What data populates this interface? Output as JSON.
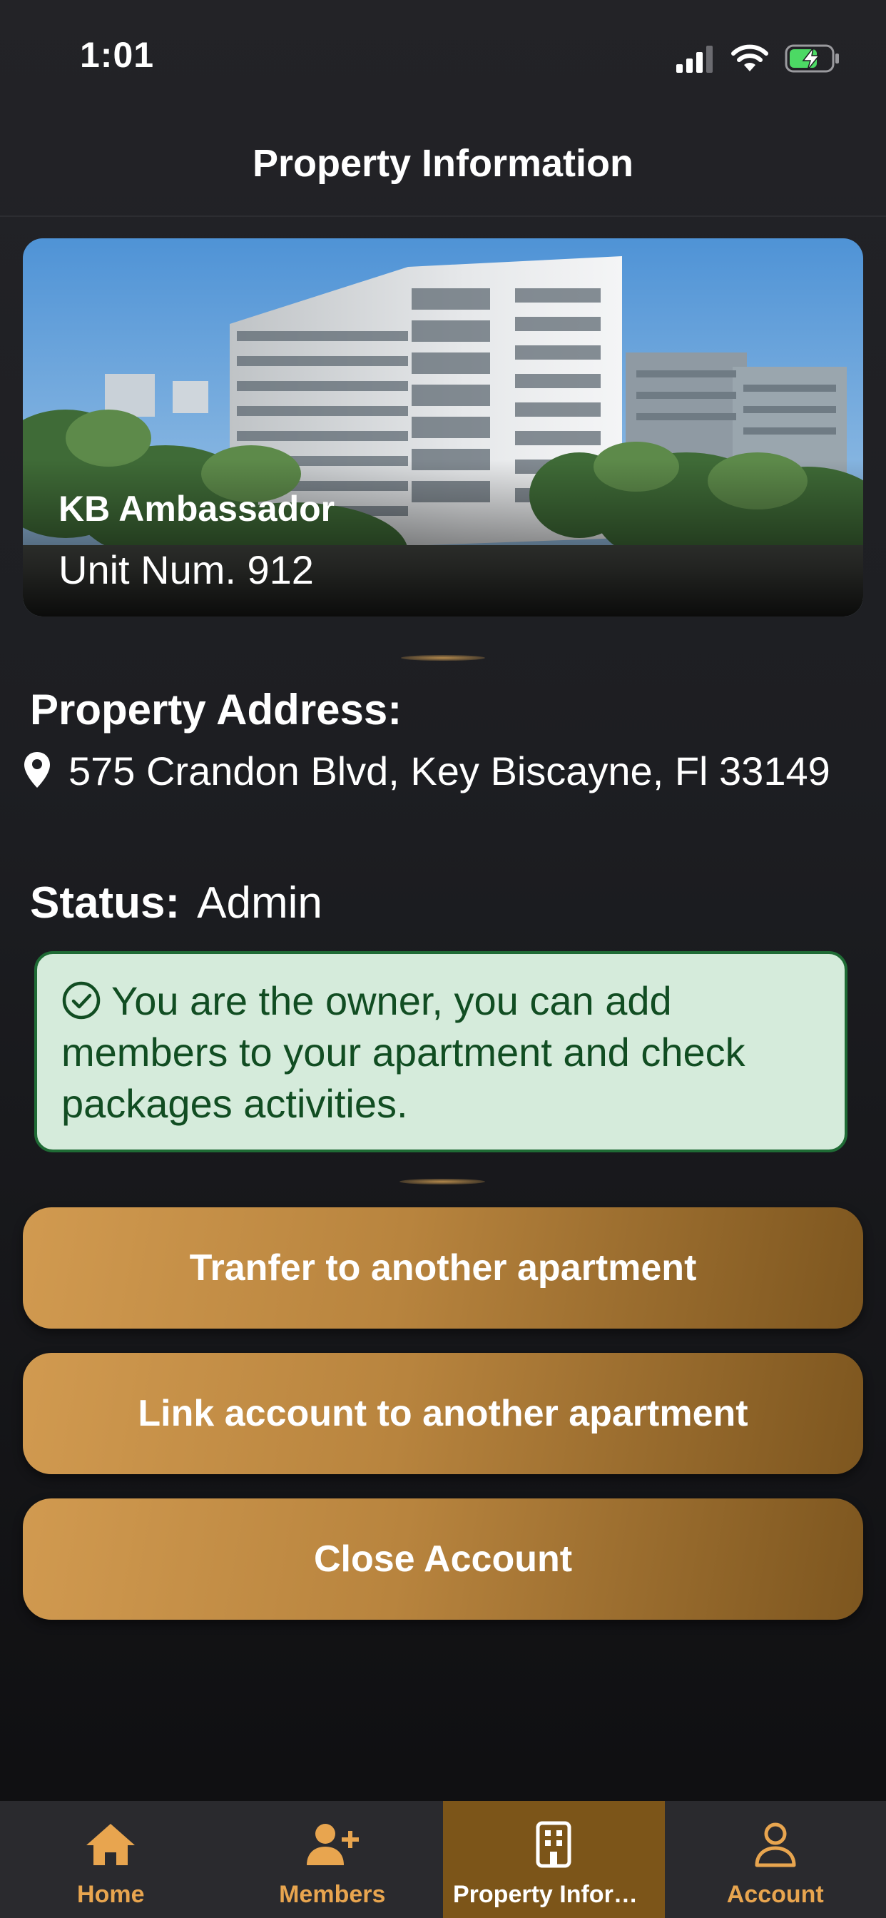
{
  "status_bar": {
    "time": "1:01"
  },
  "header": {
    "title": "Property Information"
  },
  "property": {
    "name": "KB Ambassador",
    "unit": "Unit Num. 912"
  },
  "address": {
    "heading": "Property Address:",
    "text": "575 Crandon Blvd, Key Biscayne, Fl 33149"
  },
  "status": {
    "label": "Status:",
    "value": "Admin"
  },
  "notice": {
    "text": "You are the owner, you can add members to your apartment and check packages activities."
  },
  "actions": {
    "transfer": "Tranfer to another apartment",
    "link": "Link account to another apartment",
    "close": "Close Account"
  },
  "tabs": [
    {
      "label": "Home",
      "icon": "home-icon",
      "active": false
    },
    {
      "label": "Members",
      "icon": "add-member-icon",
      "active": false
    },
    {
      "label": "Property Information",
      "icon": "building-icon",
      "active": true
    },
    {
      "label": "Account",
      "icon": "user-icon",
      "active": false
    }
  ],
  "colors": {
    "accent_gold": "#c08a45",
    "active_tab": "#7c5519",
    "success_bg": "#d5ebdb",
    "success_text": "#114d22"
  }
}
